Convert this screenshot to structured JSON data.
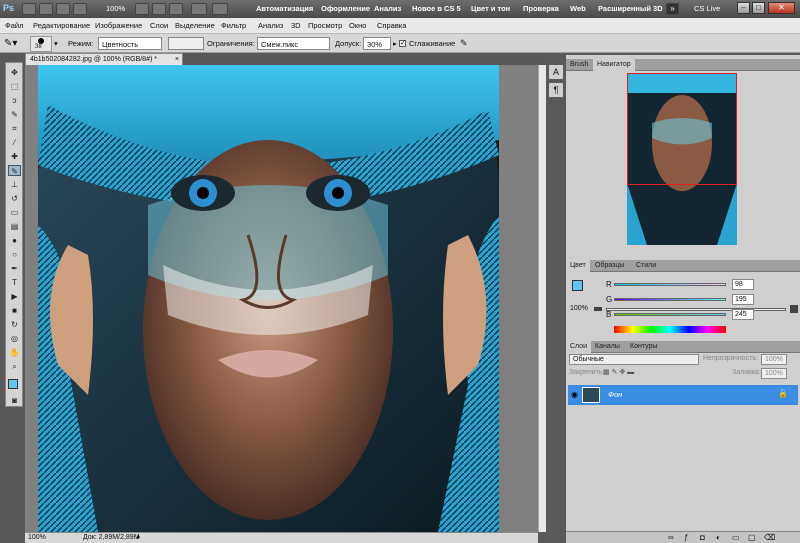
{
  "titlebar": {
    "app_logo": "Ps",
    "zoom": "100%",
    "workspaces": [
      "Автоматизация",
      "Оформление",
      "Анализ",
      "Новое в CS 5",
      "Цвет и тон",
      "Проверка",
      "Web",
      "Расширенный 3D"
    ],
    "cs_live": "CS Live"
  },
  "menu": [
    "Файл",
    "Редактирование",
    "Изображение",
    "Слои",
    "Выделение",
    "Фильтр",
    "Анализ",
    "3D",
    "Просмотр",
    "Окно",
    "Справка"
  ],
  "options": {
    "brush_size": "38",
    "mode_label": "Режим:",
    "mode_value": "Цветность",
    "limits_label": "Ограничения:",
    "limits_value": "Смеж.пикс",
    "tolerance_label": "Допуск:",
    "tolerance_value": "30%",
    "antialias_label": "Сглаживание"
  },
  "document": {
    "tab_title": "4b1b502084282.jpg @ 100% (RGB/8#) *",
    "zoom": "100%",
    "doc_size": "Док: 2,89M/2,89M"
  },
  "navigator": {
    "tabs": [
      "Brush",
      "Навигатор"
    ],
    "zoom": "100%"
  },
  "color": {
    "tabs": [
      "Цвет",
      "Образцы",
      "Стили"
    ],
    "channels": [
      {
        "label": "R",
        "value": "98"
      },
      {
        "label": "G",
        "value": "195"
      },
      {
        "label": "B",
        "value": "245"
      }
    ],
    "swatch": "#62c3f5"
  },
  "layers": {
    "tabs": [
      "Слои",
      "Каналы",
      "Контуры"
    ],
    "blend_mode": "Обычные",
    "opacity_label": "Непрозрачность:",
    "opacity_value": "100%",
    "lock_label": "Закрепить:",
    "fill_label": "Заливка:",
    "fill_value": "100%",
    "layer_name": "Фон"
  }
}
